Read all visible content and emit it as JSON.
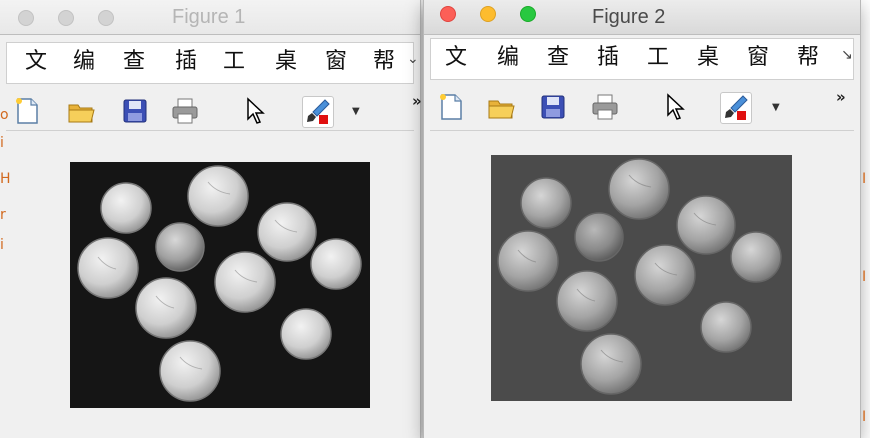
{
  "background": {
    "left_marks": [
      "o",
      "i",
      "H",
      "r",
      "i"
    ],
    "right_marks": [
      "I",
      "I",
      "I"
    ]
  },
  "windows": [
    {
      "title": "Figure 1",
      "active": false,
      "menu": [
        "文",
        "编",
        "查",
        "插",
        "工",
        "桌",
        "窗",
        "帮"
      ],
      "menu_overflow": "⌄",
      "toolbar_overflow": "»"
    },
    {
      "title": "Figure 2",
      "active": true,
      "menu": [
        "文",
        "编",
        "查",
        "插",
        "工",
        "桌",
        "窗",
        "帮"
      ],
      "menu_overflow": "↘",
      "toolbar_overflow": "»"
    }
  ],
  "toolbar": {
    "icons": [
      "new-figure-icon",
      "open-file-icon",
      "save-icon",
      "print-icon",
      "pointer-icon",
      "brush-icon"
    ]
  },
  "colors": {
    "image1_bg": "#151515",
    "image2_bg": "#4b4b4b",
    "coin1": "#d9d9d9",
    "coin2": "#a8a8a8"
  }
}
